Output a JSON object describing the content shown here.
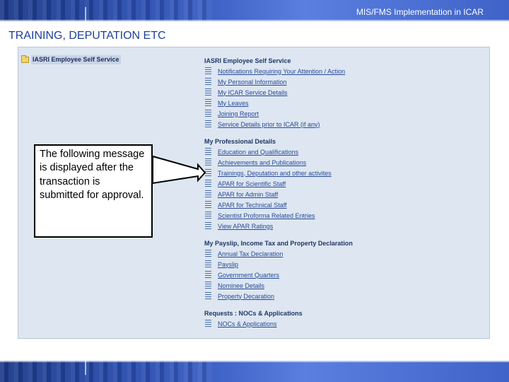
{
  "header": {
    "text": "MIS/FMS Implementation in ICAR"
  },
  "slide": {
    "title": "TRAINING, DEPUTATION ETC"
  },
  "tree": {
    "root_label": "IASRI Employee Self Service"
  },
  "menu": {
    "sections": [
      {
        "title": "IASRI Employee Self Service",
        "items": [
          "Notifications Requiring Your Attention / Action",
          "My Personal Information",
          "My ICAR Service Details",
          "My Leaves",
          "Joining Report",
          "Service Details prior to ICAR (if any)"
        ]
      },
      {
        "title": "My Professional Details",
        "items": [
          "Education and Qualifications",
          "Achievements and Publications",
          "Trainings, Deputation and other activites",
          "APAR for Scientific Staff",
          "APAR for Admin Staff",
          "APAR for Technical Staff",
          "Scientist Proforma Related Entries",
          "View APAR Ratings"
        ]
      },
      {
        "title": "My Payslip, Income Tax and Property Declaration",
        "items": [
          "Annual Tax Declaration",
          "Payslip",
          "Government Quarters",
          "Nominee Details",
          "Property Decaration"
        ]
      },
      {
        "title": "Requests : NOCs & Applications",
        "items": [
          "NOCs & Applications"
        ]
      }
    ]
  },
  "callout": {
    "text": "The following message is displayed after the transaction is submitted for approval."
  }
}
